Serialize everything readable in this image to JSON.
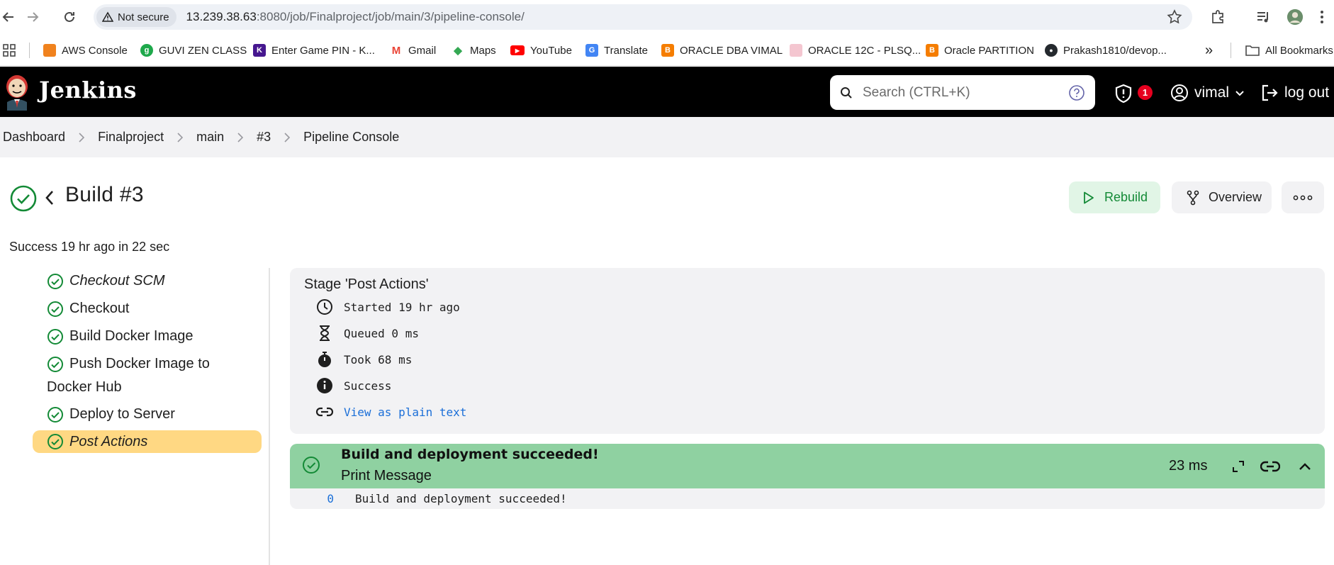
{
  "browser": {
    "security_label": "Not secure",
    "url_host": "13.239.38.63",
    "url_rest": ":8080/job/Finalproject/job/main/3/pipeline-console/",
    "bookmarks": [
      {
        "label": "AWS Console",
        "color": "#f0821e",
        "glyph": "▪"
      },
      {
        "label": "GUVI ZEN CLASS",
        "color": "#1ea84b",
        "glyph": "g"
      },
      {
        "label": "Enter Game PIN - K...",
        "color": "#46178f",
        "glyph": "K"
      },
      {
        "label": "Gmail",
        "color": "#ea4335",
        "glyph": "M"
      },
      {
        "label": "Maps",
        "color": "#34a853",
        "glyph": "◆"
      },
      {
        "label": "YouTube",
        "color": "#ff0000",
        "glyph": "▶"
      },
      {
        "label": "Translate",
        "color": "#4285f4",
        "glyph": "G"
      },
      {
        "label": "ORACLE DBA VIMAL",
        "color": "#f57d00",
        "glyph": "B"
      },
      {
        "label": "ORACLE 12C - PLSQ...",
        "color": "#f4c6d0",
        "glyph": "▪"
      },
      {
        "label": "Oracle PARTITION",
        "color": "#f57d00",
        "glyph": "B"
      },
      {
        "label": "Prakash1810/devop...",
        "color": "#24292e",
        "glyph": "●"
      }
    ],
    "more_bookmarks": "»",
    "all_bookmarks": "All Bookmarks"
  },
  "jenkins": {
    "brand": "Jenkins",
    "search_placeholder": "Search (CTRL+K)",
    "alert_count": "1",
    "username": "vimal",
    "logout_label": "log out"
  },
  "breadcrumb": [
    "Dashboard",
    "Finalproject",
    "main",
    "#3",
    "Pipeline Console"
  ],
  "build": {
    "title": "Build #3",
    "subtitle": "Success 19 hr ago in 22 sec",
    "rebuild_label": "Rebuild",
    "overview_label": "Overview"
  },
  "stages": [
    {
      "label": "Checkout SCM",
      "italic": true
    },
    {
      "label": "Checkout",
      "italic": false
    },
    {
      "label": "Build Docker Image",
      "italic": false
    },
    {
      "label": "Push Docker Image to Docker Hub",
      "italic": false
    },
    {
      "label": "Deploy to Server",
      "italic": false
    },
    {
      "label": "Post Actions",
      "italic": true,
      "active": true
    }
  ],
  "stage_details": {
    "heading": "Stage 'Post Actions'",
    "started": "Started 19 hr ago",
    "queued": "Queued 0 ms",
    "took": "Took 68 ms",
    "status": "Success",
    "plain_text_link": "View as plain text"
  },
  "step": {
    "title": "Build and deployment succeeded!",
    "subtitle": "Print Message",
    "duration": "23 ms",
    "log": [
      {
        "line": "0",
        "text": "Build and deployment succeeded!"
      }
    ]
  },
  "colors": {
    "success": "#138a36",
    "active_stage": "#ffd883",
    "step_header": "#8fd1a1",
    "link": "#1b6fd8"
  }
}
